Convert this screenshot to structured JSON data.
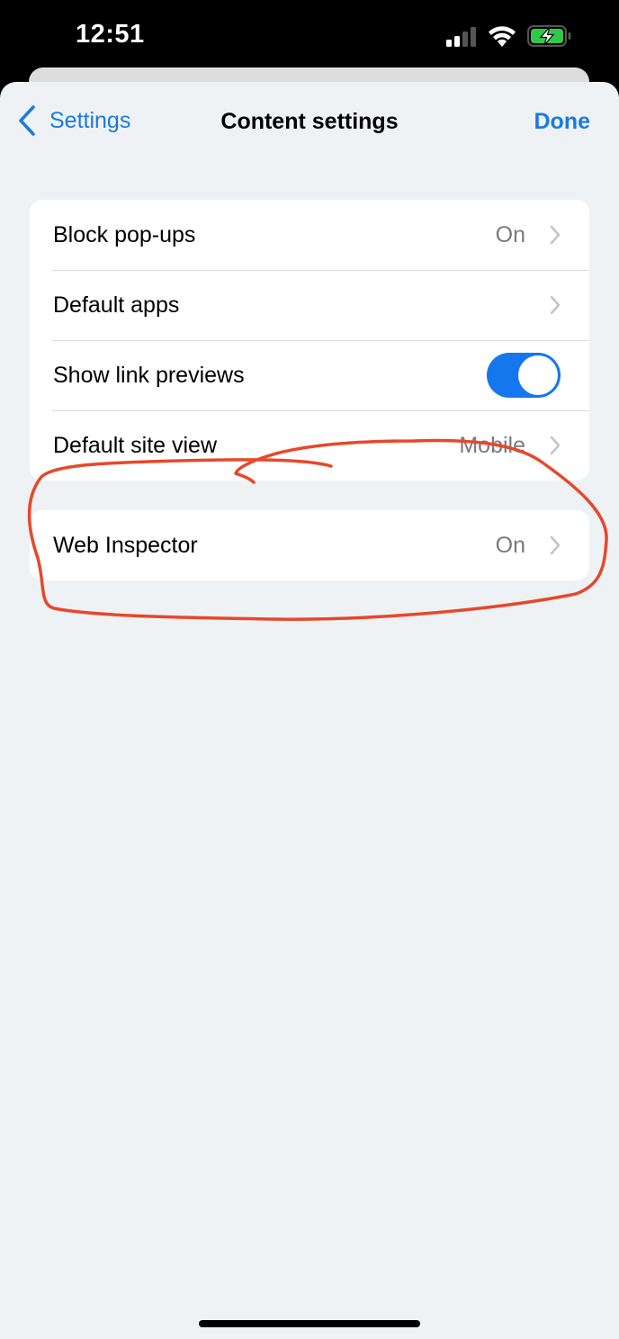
{
  "status_bar": {
    "time": "12:51",
    "signal_icon": "cellular-signal-icon",
    "wifi_icon": "wifi-icon",
    "battery_icon": "battery-charging-icon",
    "battery_color": "#2fc94a"
  },
  "nav": {
    "back_label": "Settings",
    "title": "Content settings",
    "done_label": "Done",
    "accent_color": "#1a7ae0"
  },
  "groups": [
    {
      "rows": [
        {
          "label": "Block pop-ups",
          "value": "On",
          "accessory": "chevron"
        },
        {
          "label": "Default apps",
          "value": "",
          "accessory": "chevron"
        },
        {
          "label": "Show link previews",
          "accessory": "toggle",
          "toggle_on": true
        },
        {
          "label": "Default site view",
          "value": "Mobile",
          "accessory": "chevron"
        }
      ]
    },
    {
      "rows": [
        {
          "label": "Web Inspector",
          "value": "On",
          "accessory": "chevron"
        }
      ]
    }
  ],
  "annotation": {
    "type": "hand-drawn circle with arrow",
    "target": "Web Inspector",
    "color": "#e8472a"
  }
}
